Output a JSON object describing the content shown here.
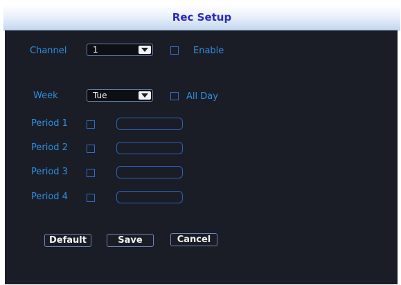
{
  "window": {
    "title": "Rec Setup"
  },
  "channel": {
    "label": "Channel",
    "value": "1",
    "enable_label": "Enable",
    "enable_checked": false
  },
  "week": {
    "label": "Week",
    "value": "Tue",
    "allday_label": "All Day",
    "allday_checked": false
  },
  "periods": [
    {
      "label": "Period 1",
      "checked": false,
      "time": ""
    },
    {
      "label": "Period 2",
      "checked": false,
      "time": ""
    },
    {
      "label": "Period 3",
      "checked": false,
      "time": ""
    },
    {
      "label": "Period 4",
      "checked": false,
      "time": ""
    }
  ],
  "buttons": {
    "default": "Default",
    "save": "Save",
    "cancel": "Cancel"
  },
  "colors": {
    "panel_bg": "#1b1d26",
    "label": "#2c8fe0",
    "title_text": "#2c2bb8",
    "control_border": "#2e5fb8"
  }
}
